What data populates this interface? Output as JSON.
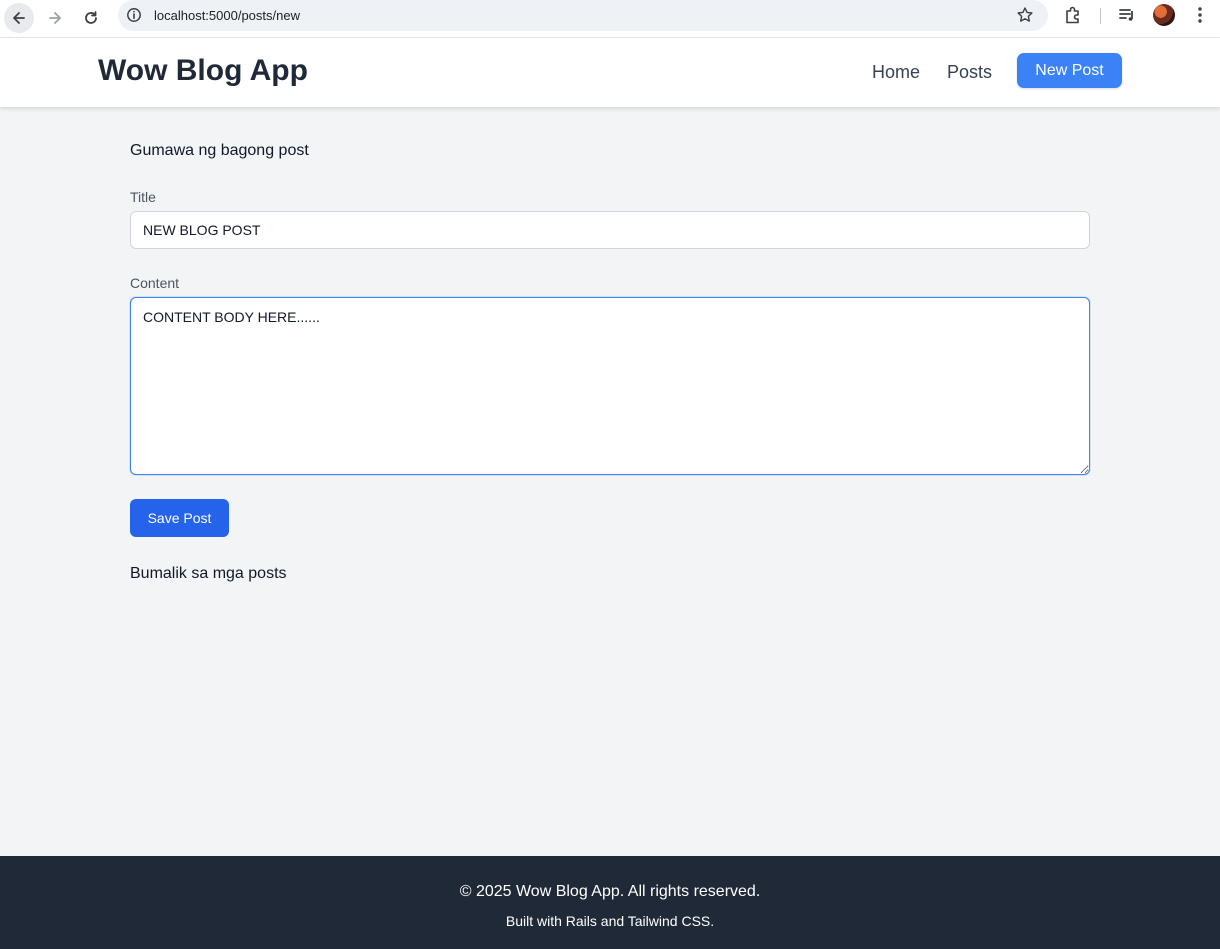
{
  "browser": {
    "url": "localhost:5000/posts/new"
  },
  "header": {
    "brand": "Wow Blog App",
    "nav": {
      "home": "Home",
      "posts": "Posts",
      "new_post": "New Post"
    },
    "accent_color": "#3b82f6"
  },
  "form": {
    "heading": "Gumawa ng bagong post",
    "title_label": "Title",
    "title_value": "NEW BLOG POST",
    "content_label": "Content",
    "content_value": "CONTENT BODY HERE......",
    "save_label": "Save Post",
    "back_link": "Bumalik sa mga posts"
  },
  "footer": {
    "copyright": "© 2025 Wow Blog App. All rights reserved.",
    "built_with": "Built with Rails and Tailwind CSS."
  },
  "icons": [
    "back-arrow-icon",
    "forward-arrow-icon",
    "reload-icon",
    "site-info-icon",
    "bookmark-star-icon",
    "extensions-icon",
    "media-control-icon",
    "profile-avatar",
    "more-menu-icon"
  ]
}
